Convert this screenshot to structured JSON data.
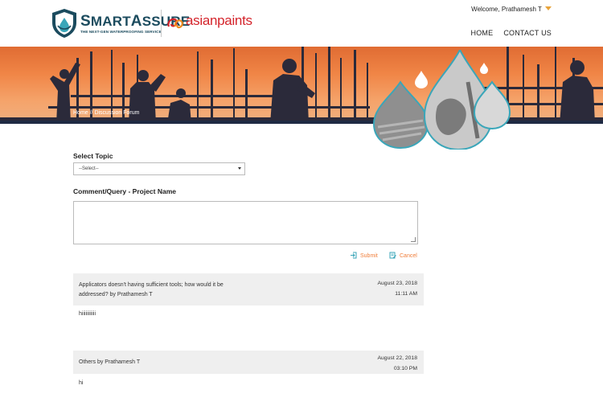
{
  "brand": {
    "smartassure_title_big": "S",
    "smartassure_title_rest": "MART",
    "smartassure_title_big2": "A",
    "smartassure_title_rest2": "SSURE",
    "smartassure_tagline": "THE NEXT-GEN WATERPROOFING SERVICE",
    "partner_name": "asianpaints",
    "colors": {
      "navy": "#1b4b5e",
      "teal": "#3aa6b9",
      "red": "#d4242b",
      "orange": "#f07e3a"
    }
  },
  "user": {
    "welcome": "Welcome, Prathamesh T"
  },
  "nav": {
    "items": [
      "HOME",
      "CONTACT US"
    ]
  },
  "banner": {
    "breadcrumb": "Home // Discussion Forum"
  },
  "form": {
    "topic_label": "Select Topic",
    "topic_value": "--Select--",
    "comment_label": "Comment/Query - Project Name",
    "comment_value": "",
    "submit_label": "Submit",
    "cancel_label": "Cancel"
  },
  "posts": [
    {
      "question_line1": "Applicators doesn't having sufficient tools; how would it be",
      "question_line2": "addressed? by Prathamesh T",
      "date": "August 23, 2018",
      "time": "11:11 AM",
      "body": "hiiiiiiiiiii"
    },
    {
      "question_line1": "Others by Prathamesh T",
      "question_line2": "",
      "date": "August 22, 2018",
      "time": "03:10 PM",
      "body": "hi"
    }
  ]
}
